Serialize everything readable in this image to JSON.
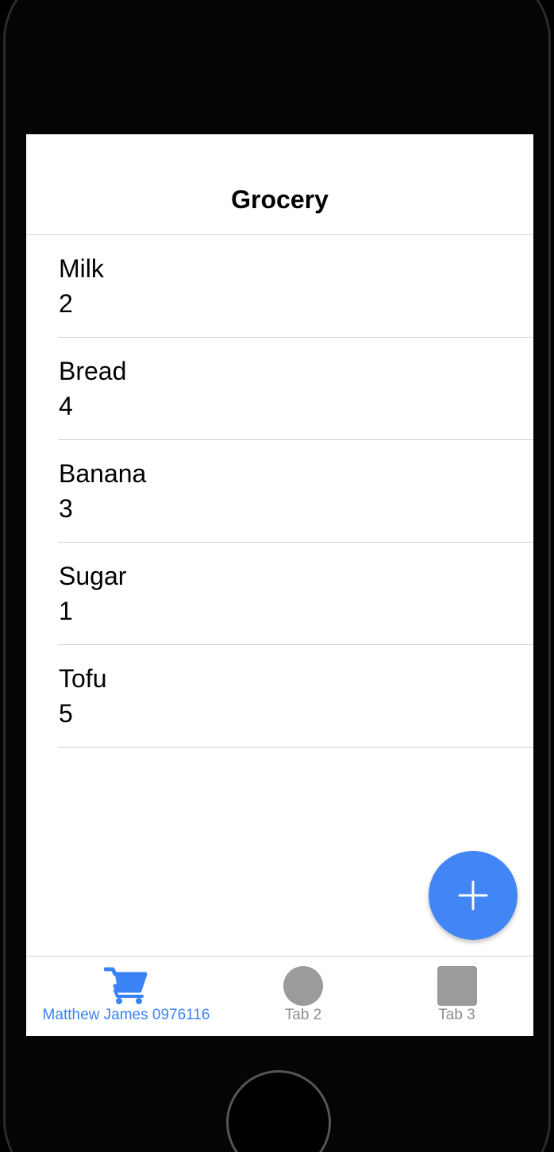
{
  "nav": {
    "title": "Grocery"
  },
  "items": [
    {
      "name": "Milk",
      "quantity": "2"
    },
    {
      "name": "Bread",
      "quantity": "4"
    },
    {
      "name": "Banana",
      "quantity": "3"
    },
    {
      "name": "Sugar",
      "quantity": "1"
    },
    {
      "name": "Tofu",
      "quantity": "5"
    }
  ],
  "fab": {
    "icon": "plus-icon",
    "color": "#4285f4"
  },
  "tabs": [
    {
      "label": "Matthew James 0976116",
      "icon": "cart-icon",
      "active": true
    },
    {
      "label": "Tab 2",
      "icon": "circle-icon",
      "active": false
    },
    {
      "label": "Tab 3",
      "icon": "square-icon",
      "active": false
    }
  ],
  "colors": {
    "accent": "#3b82f6",
    "inactive": "#8e8e8e",
    "inactive_icon": "#9b9b9b"
  }
}
